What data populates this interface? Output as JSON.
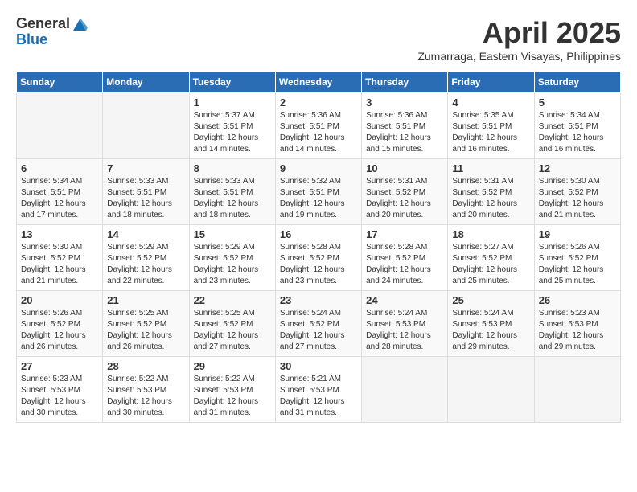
{
  "logo": {
    "general": "General",
    "blue": "Blue"
  },
  "title": {
    "month_year": "April 2025",
    "location": "Zumarraga, Eastern Visayas, Philippines"
  },
  "headers": [
    "Sunday",
    "Monday",
    "Tuesday",
    "Wednesday",
    "Thursday",
    "Friday",
    "Saturday"
  ],
  "weeks": [
    [
      {
        "day": "",
        "info": ""
      },
      {
        "day": "",
        "info": ""
      },
      {
        "day": "1",
        "info": "Sunrise: 5:37 AM\nSunset: 5:51 PM\nDaylight: 12 hours\nand 14 minutes."
      },
      {
        "day": "2",
        "info": "Sunrise: 5:36 AM\nSunset: 5:51 PM\nDaylight: 12 hours\nand 14 minutes."
      },
      {
        "day": "3",
        "info": "Sunrise: 5:36 AM\nSunset: 5:51 PM\nDaylight: 12 hours\nand 15 minutes."
      },
      {
        "day": "4",
        "info": "Sunrise: 5:35 AM\nSunset: 5:51 PM\nDaylight: 12 hours\nand 16 minutes."
      },
      {
        "day": "5",
        "info": "Sunrise: 5:34 AM\nSunset: 5:51 PM\nDaylight: 12 hours\nand 16 minutes."
      }
    ],
    [
      {
        "day": "6",
        "info": "Sunrise: 5:34 AM\nSunset: 5:51 PM\nDaylight: 12 hours\nand 17 minutes."
      },
      {
        "day": "7",
        "info": "Sunrise: 5:33 AM\nSunset: 5:51 PM\nDaylight: 12 hours\nand 18 minutes."
      },
      {
        "day": "8",
        "info": "Sunrise: 5:33 AM\nSunset: 5:51 PM\nDaylight: 12 hours\nand 18 minutes."
      },
      {
        "day": "9",
        "info": "Sunrise: 5:32 AM\nSunset: 5:51 PM\nDaylight: 12 hours\nand 19 minutes."
      },
      {
        "day": "10",
        "info": "Sunrise: 5:31 AM\nSunset: 5:52 PM\nDaylight: 12 hours\nand 20 minutes."
      },
      {
        "day": "11",
        "info": "Sunrise: 5:31 AM\nSunset: 5:52 PM\nDaylight: 12 hours\nand 20 minutes."
      },
      {
        "day": "12",
        "info": "Sunrise: 5:30 AM\nSunset: 5:52 PM\nDaylight: 12 hours\nand 21 minutes."
      }
    ],
    [
      {
        "day": "13",
        "info": "Sunrise: 5:30 AM\nSunset: 5:52 PM\nDaylight: 12 hours\nand 21 minutes."
      },
      {
        "day": "14",
        "info": "Sunrise: 5:29 AM\nSunset: 5:52 PM\nDaylight: 12 hours\nand 22 minutes."
      },
      {
        "day": "15",
        "info": "Sunrise: 5:29 AM\nSunset: 5:52 PM\nDaylight: 12 hours\nand 23 minutes."
      },
      {
        "day": "16",
        "info": "Sunrise: 5:28 AM\nSunset: 5:52 PM\nDaylight: 12 hours\nand 23 minutes."
      },
      {
        "day": "17",
        "info": "Sunrise: 5:28 AM\nSunset: 5:52 PM\nDaylight: 12 hours\nand 24 minutes."
      },
      {
        "day": "18",
        "info": "Sunrise: 5:27 AM\nSunset: 5:52 PM\nDaylight: 12 hours\nand 25 minutes."
      },
      {
        "day": "19",
        "info": "Sunrise: 5:26 AM\nSunset: 5:52 PM\nDaylight: 12 hours\nand 25 minutes."
      }
    ],
    [
      {
        "day": "20",
        "info": "Sunrise: 5:26 AM\nSunset: 5:52 PM\nDaylight: 12 hours\nand 26 minutes."
      },
      {
        "day": "21",
        "info": "Sunrise: 5:25 AM\nSunset: 5:52 PM\nDaylight: 12 hours\nand 26 minutes."
      },
      {
        "day": "22",
        "info": "Sunrise: 5:25 AM\nSunset: 5:52 PM\nDaylight: 12 hours\nand 27 minutes."
      },
      {
        "day": "23",
        "info": "Sunrise: 5:24 AM\nSunset: 5:52 PM\nDaylight: 12 hours\nand 27 minutes."
      },
      {
        "day": "24",
        "info": "Sunrise: 5:24 AM\nSunset: 5:53 PM\nDaylight: 12 hours\nand 28 minutes."
      },
      {
        "day": "25",
        "info": "Sunrise: 5:24 AM\nSunset: 5:53 PM\nDaylight: 12 hours\nand 29 minutes."
      },
      {
        "day": "26",
        "info": "Sunrise: 5:23 AM\nSunset: 5:53 PM\nDaylight: 12 hours\nand 29 minutes."
      }
    ],
    [
      {
        "day": "27",
        "info": "Sunrise: 5:23 AM\nSunset: 5:53 PM\nDaylight: 12 hours\nand 30 minutes."
      },
      {
        "day": "28",
        "info": "Sunrise: 5:22 AM\nSunset: 5:53 PM\nDaylight: 12 hours\nand 30 minutes."
      },
      {
        "day": "29",
        "info": "Sunrise: 5:22 AM\nSunset: 5:53 PM\nDaylight: 12 hours\nand 31 minutes."
      },
      {
        "day": "30",
        "info": "Sunrise: 5:21 AM\nSunset: 5:53 PM\nDaylight: 12 hours\nand 31 minutes."
      },
      {
        "day": "",
        "info": ""
      },
      {
        "day": "",
        "info": ""
      },
      {
        "day": "",
        "info": ""
      }
    ]
  ]
}
